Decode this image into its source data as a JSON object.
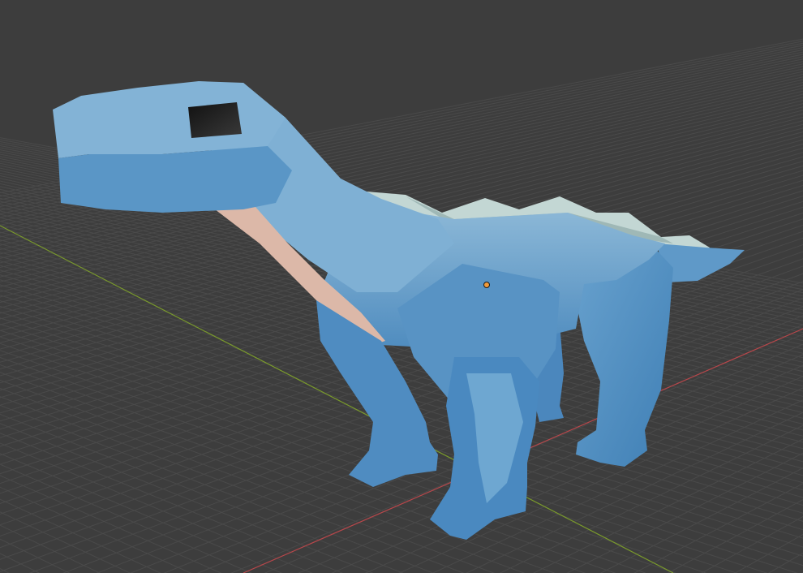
{
  "viewport": {
    "background_color": "#3d3d3d",
    "grid_line_color": "#4a4a4a",
    "x_axis_color": "#b8474b",
    "y_axis_color": "#7a9a2c"
  },
  "model": {
    "body_color": "#5a95c5",
    "body_light_color": "#8ab6d5",
    "belly_color": "#dcb8a8",
    "spikes_color": "#c3d7d4",
    "eye_color": "#1e1e1e",
    "origin_marker_color": "#f09a3a"
  }
}
